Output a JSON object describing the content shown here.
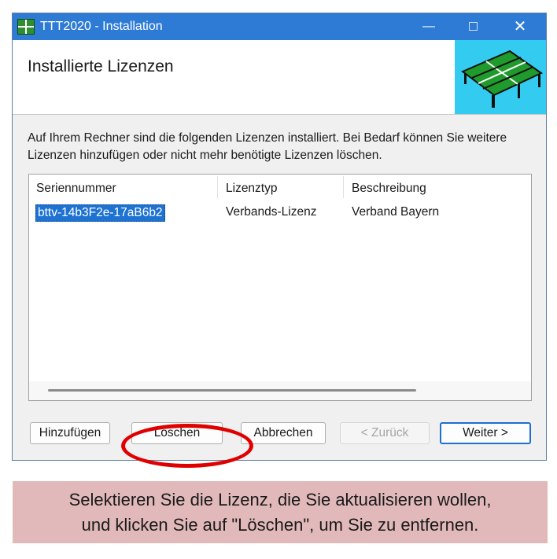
{
  "window": {
    "title": "TTT2020 - Installation",
    "icon": "table-tennis-app-icon",
    "controls": {
      "minimize": "—",
      "maximize": "maximize-icon",
      "close": "✕"
    }
  },
  "header": {
    "title": "Installierte Lizenzen",
    "graphic": "table-tennis-table-icon"
  },
  "description": "Auf Ihrem Rechner sind die folgenden Lizenzen installiert. Bei Bedarf können Sie weitere Lizenzen hinzufügen oder nicht mehr benötigte Lizenzen löschen.",
  "license_list": {
    "columns": [
      "Seriennummer",
      "Lizenztyp",
      "Beschreibung"
    ],
    "rows": [
      {
        "serial": "bttv-14b3F2e-17aB6b2",
        "type": "Verbands-Lizenz",
        "description": "Verband Bayern",
        "selected": true
      }
    ]
  },
  "buttons": {
    "add": "Hinzufügen",
    "delete": "Löschen",
    "cancel": "Abbrechen",
    "back": "< Zurück",
    "next": "Weiter >"
  },
  "annotation": {
    "color": "#e00000",
    "caption_line1": "Selektieren Sie die Lizenz, die Sie aktualisieren wollen,",
    "caption_line2": "und klicken Sie auf \"Löschen\", um Sie zu entfernen.",
    "caption_bg": "#e2b9ba"
  },
  "colors": {
    "titlebar": "#2e7bd6",
    "selection": "#1e72d2",
    "header_graphic_bg": "#33ccf0"
  }
}
